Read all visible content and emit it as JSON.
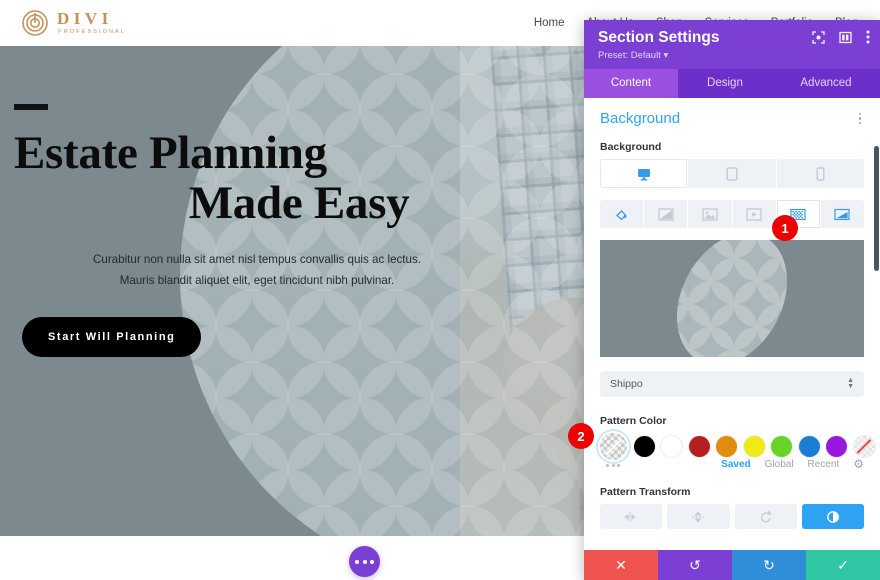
{
  "site": {
    "logo": {
      "name": "DIVI",
      "subtitle": "PROFESSIONAL"
    },
    "nav": [
      "Home",
      "About Us",
      "Shop",
      "Services",
      "Portfolio",
      "Blog"
    ],
    "hero": {
      "title_line1": "Estate Planning",
      "title_line2": "Made Easy",
      "subtitle_line1": "Curabitur non nulla sit amet nisl tempus convallis quis ac lectus.",
      "subtitle_line2": "Mauris blandit aliquet elit, eget tincidunt nibh pulvinar.",
      "cta_label": "Start Will Planning",
      "bg_color": "#7c8a90",
      "pattern_overlay_color": "#96a8ad"
    },
    "fab_label": "page-settings-menu"
  },
  "panel": {
    "title": "Section Settings",
    "preset": "Preset: Default",
    "header_icons": [
      "target-icon",
      "layout-icon",
      "kebab-menu-icon"
    ],
    "tabs": [
      {
        "label": "Content",
        "active": true
      },
      {
        "label": "Design",
        "active": false
      },
      {
        "label": "Advanced",
        "active": false
      }
    ],
    "section": {
      "title": "Background",
      "field_label": "Background",
      "devices": [
        {
          "name": "desktop",
          "active": true
        },
        {
          "name": "tablet",
          "active": false
        },
        {
          "name": "phone",
          "active": false
        }
      ],
      "bg_types": [
        {
          "name": "color",
          "active": false
        },
        {
          "name": "gradient",
          "active": false
        },
        {
          "name": "image",
          "active": false
        },
        {
          "name": "video",
          "active": false
        },
        {
          "name": "pattern",
          "active": true
        },
        {
          "name": "mask",
          "active": false
        }
      ],
      "pattern_select": {
        "value": "Shippo"
      },
      "pattern_color": {
        "label": "Pattern Color",
        "selected": "transparent-checker",
        "swatches": [
          {
            "name": "transparent-checker",
            "hex": "transparent",
            "selected": true
          },
          {
            "name": "black",
            "hex": "#000000"
          },
          {
            "name": "white",
            "hex": "#ffffff"
          },
          {
            "name": "dark-red",
            "hex": "#b61f1f"
          },
          {
            "name": "orange",
            "hex": "#e08c0c"
          },
          {
            "name": "yellow",
            "hex": "#eeea15"
          },
          {
            "name": "green",
            "hex": "#68d427"
          },
          {
            "name": "blue",
            "hex": "#1a7fd4"
          },
          {
            "name": "purple",
            "hex": "#9a17e0"
          },
          {
            "name": "none",
            "hex": "none"
          }
        ],
        "tabs": [
          {
            "label": "Saved",
            "active": true
          },
          {
            "label": "Global",
            "active": false
          },
          {
            "label": "Recent",
            "active": false
          }
        ]
      },
      "pattern_transform": {
        "label": "Pattern Transform",
        "buttons": [
          {
            "name": "flip-horizontal",
            "active": false
          },
          {
            "name": "flip-vertical",
            "active": false
          },
          {
            "name": "rotate",
            "active": false
          },
          {
            "name": "invert",
            "active": true
          }
        ]
      }
    },
    "actions": [
      {
        "name": "cancel",
        "glyph": "✕",
        "color": "#ef5350"
      },
      {
        "name": "undo",
        "glyph": "↺",
        "color": "#7b3fd4"
      },
      {
        "name": "redo",
        "glyph": "↻",
        "color": "#2e8fd8"
      },
      {
        "name": "save",
        "glyph": "✓",
        "color": "#2fc6a4"
      }
    ]
  },
  "annotations": [
    {
      "number": "1",
      "target": "pattern-background-type-button"
    },
    {
      "number": "2",
      "target": "pattern-color-transparent-swatch"
    }
  ]
}
